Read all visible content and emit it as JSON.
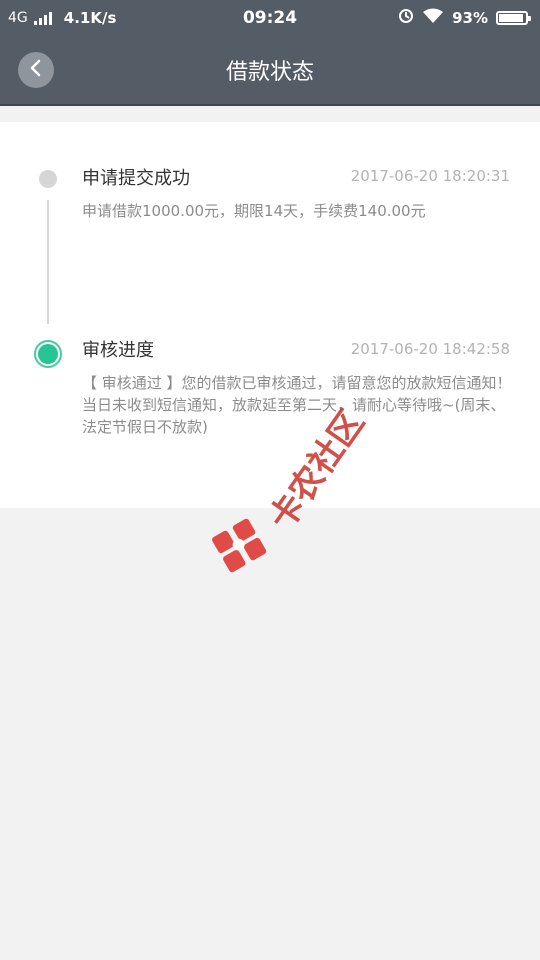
{
  "status_bar": {
    "network": "4G",
    "speed": "4.1K/s",
    "time": "09:24",
    "battery": "93%",
    "battery_level": 0.93
  },
  "header": {
    "back_icon": "chevron-left-icon",
    "title": "借款状态"
  },
  "timeline": [
    {
      "title": "申请提交成功",
      "time": "2017-06-20 18:20:31",
      "desc": "申请借款1000.00元，期限14天，手续费140.00元",
      "state": "done"
    },
    {
      "title": "审核进度",
      "time": "2017-06-20 18:42:58",
      "desc": "【 审核通过 】您的借款已审核通过，请留意您的放款短信通知！当日未收到短信通知，放款延至第二天，请耐心等待哦~(周末、法定节假日不放款)",
      "state": "current"
    }
  ],
  "watermark": {
    "text": "卡农社区"
  },
  "colors": {
    "header_bg": "#545c66",
    "accent_green": "#27c494",
    "page_bg": "#f2f2f2"
  }
}
